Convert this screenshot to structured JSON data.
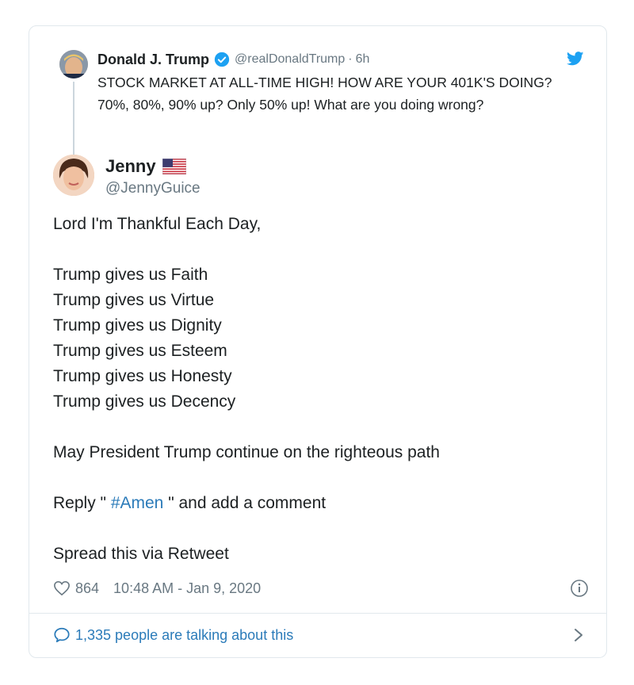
{
  "quoted_tweet": {
    "author_name": "Donald J. Trump",
    "handle": "@realDonaldTrump",
    "separator": "·",
    "time": "6h",
    "text": "STOCK MARKET AT ALL-TIME HIGH! HOW ARE YOUR 401K'S DOING? 70%, 80%, 90% up? Only 50% up! What are you doing wrong?",
    "verified_icon": "verified-badge-icon",
    "avatar_icon": "avatar"
  },
  "tweet": {
    "author_name": "Jenny",
    "handle": "@JennyGuice",
    "flag_icon": "us-flag-icon",
    "lines": {
      "l1": "Lord I'm Thankful Each Day,",
      "l2": "Trump gives us Faith",
      "l3": "Trump gives us Virtue",
      "l4": "Trump gives us Dignity",
      "l5": "Trump gives us Esteem",
      "l6": "Trump gives us Honesty",
      "l7": "Trump gives us Decency",
      "l8": "May President Trump continue on the righteous path",
      "l9_pre": "Reply \" ",
      "l9_tag": "#Amen",
      "l9_post": " \" and add a comment",
      "l10": "Spread this via Retweet"
    },
    "likes": "864",
    "timestamp": "10:48 AM - Jan 9, 2020"
  },
  "footer": {
    "talking": "1,335 people are talking about this"
  },
  "colors": {
    "link": "#2b7bb9",
    "muted": "#697882",
    "border": "#e1e8ed",
    "twitter_blue": "#1da1f2"
  }
}
